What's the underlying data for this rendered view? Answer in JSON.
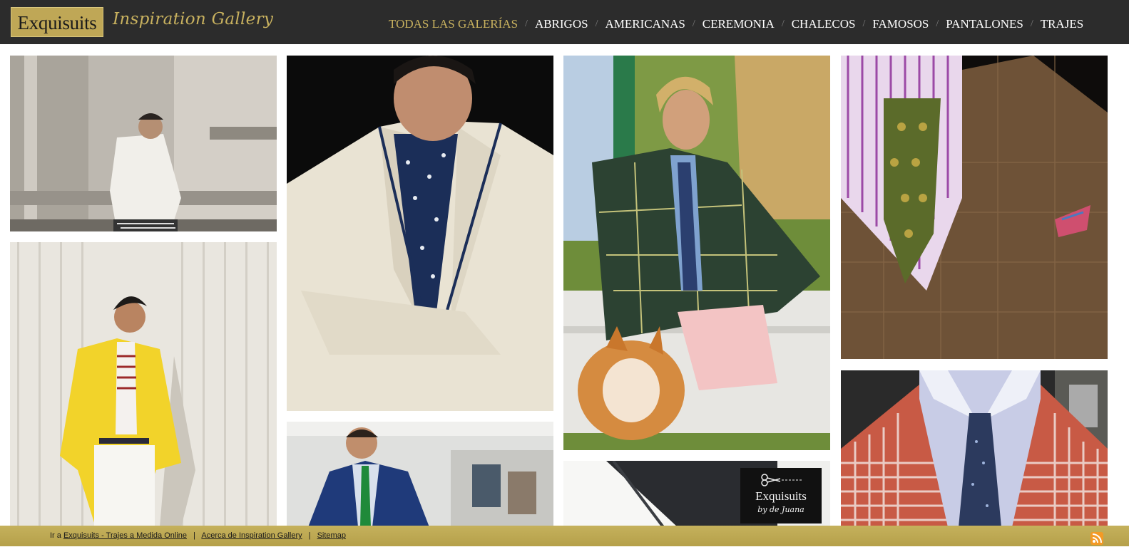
{
  "brand": {
    "logo_text": "Exquisuits",
    "subtitle": "Inspiration Gallery",
    "gold": "#bfa756",
    "header_bg": "#2c2c2c"
  },
  "nav": {
    "items": [
      {
        "label": "TODAS LAS GALERÍAS",
        "active": true
      },
      {
        "label": "ABRIGOS"
      },
      {
        "label": "AMERICANAS"
      },
      {
        "label": "CEREMONIA"
      },
      {
        "label": "CHALECOS"
      },
      {
        "label": "FAMOSOS"
      },
      {
        "label": "PANTALONES"
      },
      {
        "label": "TRAJES"
      }
    ],
    "separator": "/"
  },
  "gallery": {
    "photos": [
      {
        "subject": "man-white-double-breasted-blazer-phone"
      },
      {
        "subject": "man-yellow-blazer-striped-shirt"
      },
      {
        "subject": "man-cream-blazer-navy-polka-ascot"
      },
      {
        "subject": "man-navy-suit-green-tie"
      },
      {
        "subject": "man-green-plaid-jacket-with-corgi"
      },
      {
        "subject": "dark-suit-shoulder-with-logo"
      },
      {
        "subject": "brown-check-jacket-green-tie"
      },
      {
        "subject": "red-gingham-jacket-navy-tie"
      }
    ],
    "badge_title": "Exquisuits",
    "badge_sub": "by de Juana"
  },
  "footer": {
    "prefix": "Ir a",
    "link_home": "Exquisuits - Trajes a Medida Online",
    "link_about": "Acerca de Inspiration Gallery",
    "link_sitemap": "Sitemap",
    "separator": "|",
    "rss_icon": "rss-icon"
  }
}
